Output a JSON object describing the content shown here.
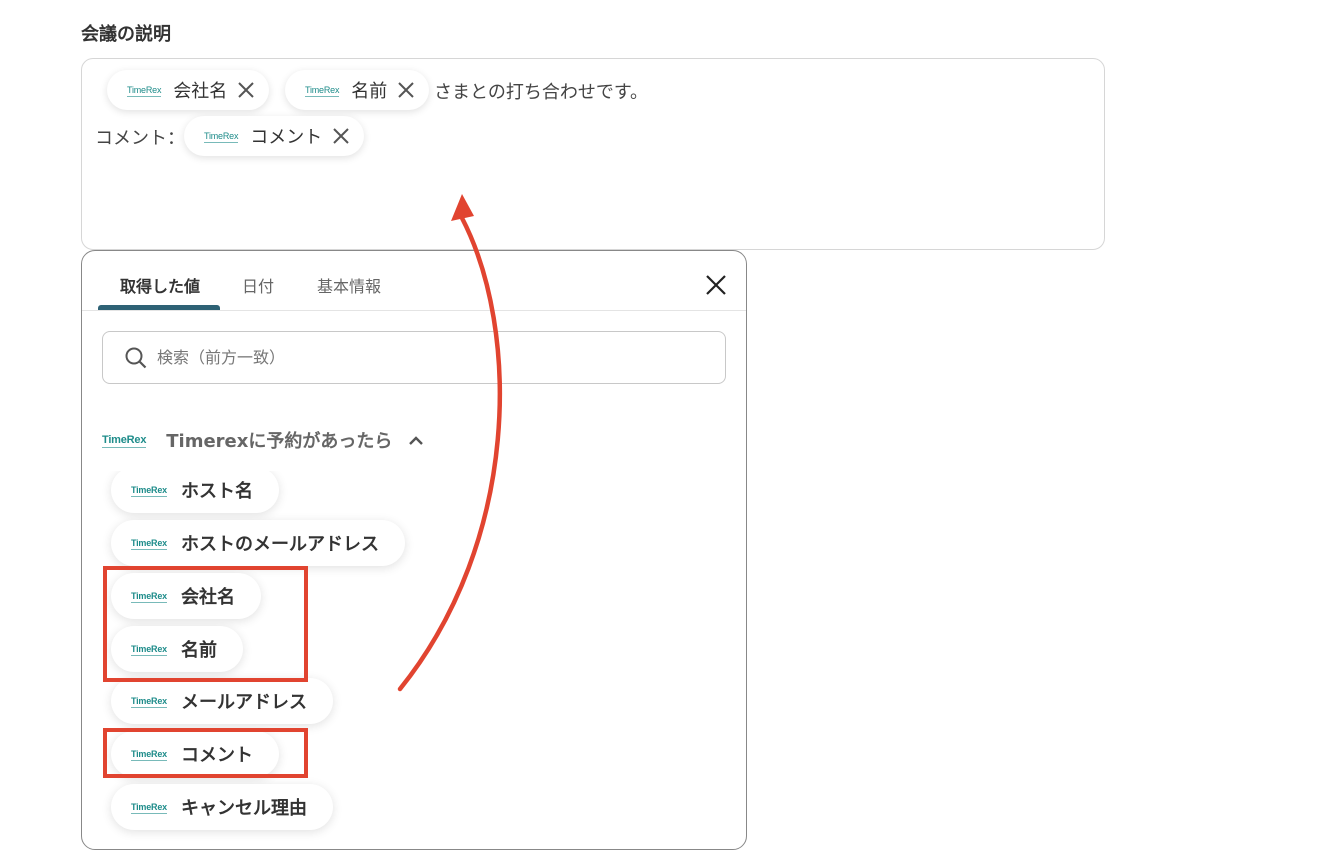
{
  "field": {
    "label": "会議の説明"
  },
  "editor": {
    "chips": {
      "company": "会社名",
      "name": "名前",
      "comment": "コメント"
    },
    "text_after_name": "さまとの打ち合わせです。",
    "comment_prefix": "コメント："
  },
  "logo_text": "TimeRex",
  "panel": {
    "tabs": [
      "取得した値",
      "日付",
      "基本情報"
    ],
    "active_tab": "取得した値",
    "search_placeholder": "検索（前方一致）",
    "section_title": "Timerexに予約があったら",
    "items": [
      "ホスト名",
      "ホストのメールアドレス",
      "会社名",
      "名前",
      "メールアドレス",
      "コメント",
      "キャンセル理由"
    ]
  },
  "colors": {
    "accent": "#2e6275",
    "highlight": "#e14430",
    "logo": "#1e8c8a"
  },
  "icons": {
    "search": "search-icon",
    "close": "close-icon",
    "chip_remove": "close-icon",
    "collapse": "chevron-up-icon"
  }
}
